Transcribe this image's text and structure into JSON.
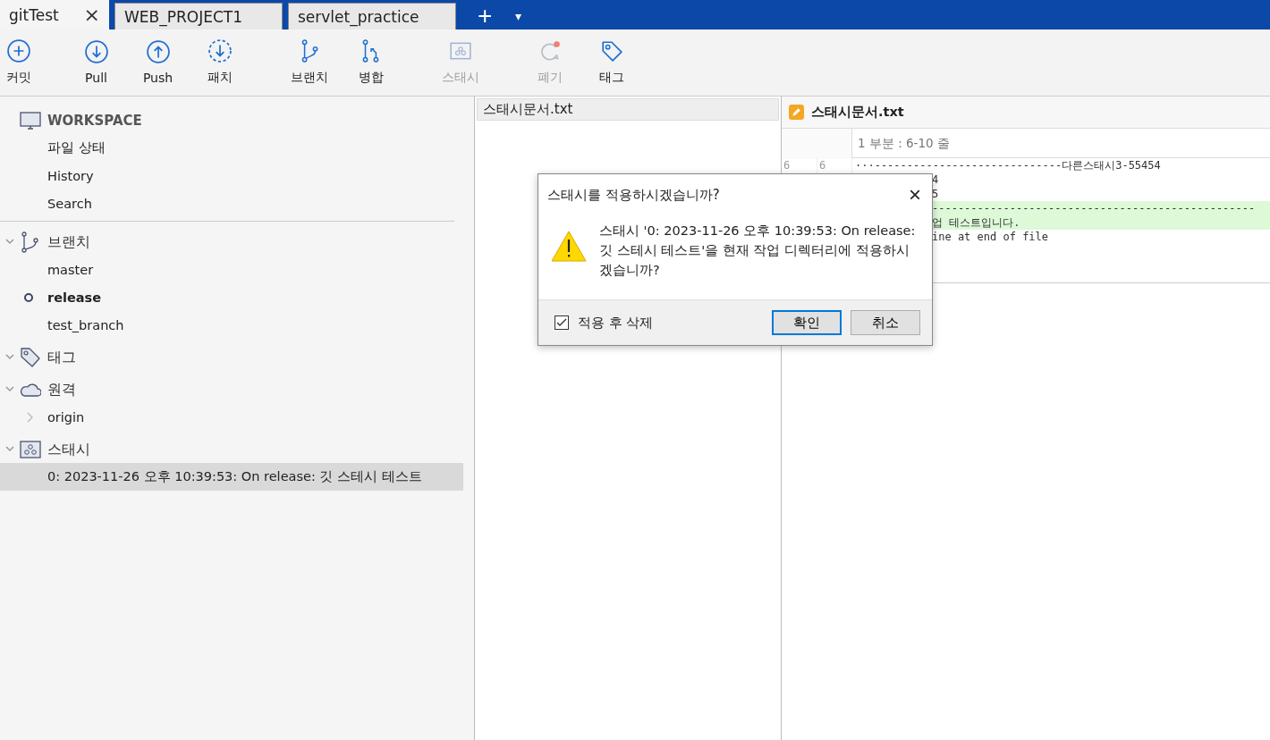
{
  "tabs": [
    {
      "label": "gitTest",
      "selected": true,
      "close": "×"
    },
    {
      "label": "WEB_PROJECT1",
      "selected": false
    },
    {
      "label": "servlet_practice",
      "selected": false
    }
  ],
  "tab_actions": {
    "add": "+",
    "menu": "▾"
  },
  "toolbar": [
    {
      "kind": "commit",
      "label": "커밋",
      "disabled": false
    },
    {
      "kind": "pull",
      "label": "Pull",
      "disabled": false
    },
    {
      "kind": "push",
      "label": "Push",
      "disabled": false
    },
    {
      "kind": "fetch",
      "label": "패치",
      "disabled": false
    },
    {
      "kind": "branch",
      "label": "브랜치",
      "disabled": false
    },
    {
      "kind": "merge",
      "label": "병합",
      "disabled": false
    },
    {
      "kind": "stash",
      "label": "스태시",
      "disabled": true
    },
    {
      "kind": "discard",
      "label": "폐기",
      "disabled": true
    },
    {
      "kind": "tag",
      "label": "태그",
      "disabled": false
    }
  ],
  "sidebar": {
    "workspace": {
      "title": "WORKSPACE",
      "items": [
        {
          "label": "파일 상태",
          "selected": false
        },
        {
          "label": "History",
          "selected": false
        },
        {
          "label": "Search",
          "selected": false
        }
      ]
    },
    "sections": [
      {
        "kind": "branch",
        "title": "브랜치",
        "expanded": true,
        "items": [
          {
            "label": "master",
            "current": false,
            "selected": false
          },
          {
            "label": "release",
            "current": true,
            "selected": false
          },
          {
            "label": "test_branch",
            "current": false,
            "selected": false
          }
        ]
      },
      {
        "kind": "tag",
        "title": "태그",
        "expanded": true
      },
      {
        "kind": "remote",
        "title": "원격",
        "expanded": true,
        "items": [
          {
            "label": "origin",
            "expandable": true,
            "selected": false
          }
        ]
      },
      {
        "kind": "stash",
        "title": "스태시",
        "expanded": true,
        "items": [
          {
            "label": "0: 2023-11-26 오후 10:39:53: On release: 깃 스테시 테스트",
            "selected": true
          }
        ]
      }
    ]
  },
  "file_list": {
    "files": [
      {
        "name": "스태시문서.txt",
        "selected": false
      }
    ]
  },
  "diff": {
    "file": "스태시문서.txt",
    "hunk": "1 부분 : 6-10 줄",
    "lines": [
      {
        "kind": "context",
        "old": "6",
        "new": "6",
        "text": "···-----------------------------다른스태시3-55454",
        "covered": false
      },
      {
        "kind": "context",
        "text": "4",
        "covered": true
      },
      {
        "kind": "context",
        "text": "5",
        "covered": true
      },
      {
        "kind": "added",
        "text": "--------------------------------------------------",
        "covered": true
      },
      {
        "kind": "added",
        "text": "업 테스트입니다.",
        "covered": true
      },
      {
        "kind": "context",
        "text": "ine at end of file",
        "covered": true
      }
    ]
  },
  "dialog": {
    "title": "스태시를 적용하시겠습니까?",
    "close": "×",
    "message": "스태시 '0: 2023-11-26 오후 10:39:53: On release: 깃 스테시 테스트'을 현재 작업 디렉터리에 적용하시겠습니까?",
    "checkbox": {
      "label": "적용 후 삭제",
      "checked": true
    },
    "buttons": [
      {
        "label": "확인",
        "default": true
      },
      {
        "label": "취소",
        "default": false
      }
    ]
  }
}
